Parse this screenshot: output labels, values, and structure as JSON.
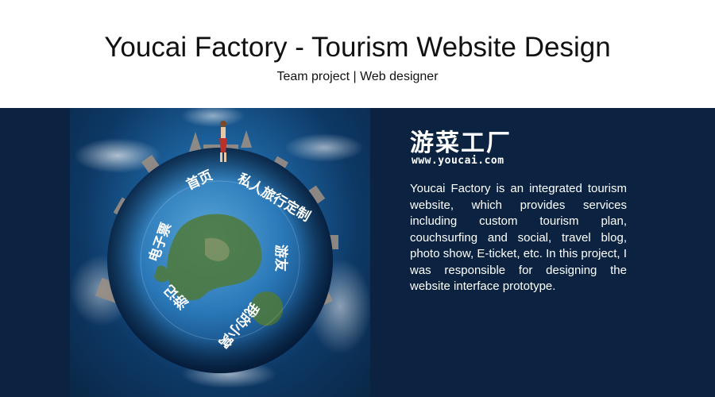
{
  "header": {
    "title": "Youcai Factory - Tourism Website Design",
    "subtitle": "Team project | Web designer"
  },
  "logo": {
    "name_cn": "游菜工厂",
    "url": "www.youcai.com"
  },
  "description": "Youcai Factory is an integrated tourism website, which provides services including custom tourism plan, couchsurfing and social, travel blog, photo show, E-ticket, etc. In this project,  I was responsible for designing the website interface prototype.",
  "globe_menu": {
    "items": [
      "首页",
      "私人旅行定制",
      "游友",
      "我的小窝",
      "游记",
      "电子票"
    ]
  },
  "colors": {
    "panel_bg": "#0b2340",
    "globe_ocean": "#2a78b8",
    "globe_land": "#4f7a3a"
  }
}
